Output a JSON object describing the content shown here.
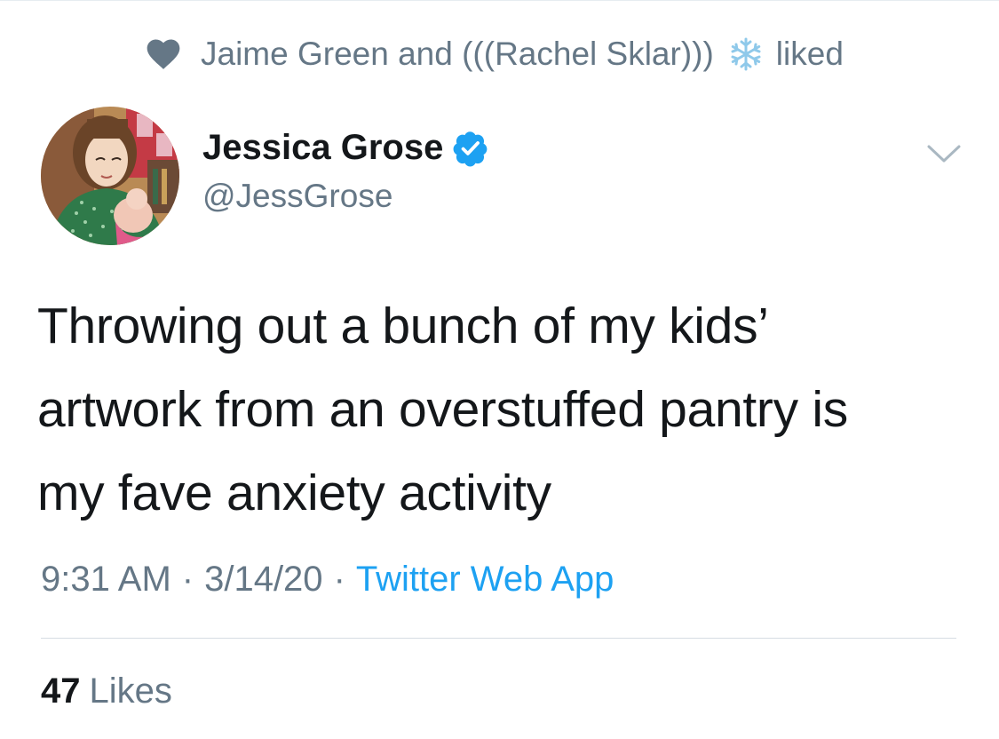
{
  "social_context": {
    "likers": "Jaime Green and (((Rachel Sklar)))",
    "action": "liked",
    "icon": "heart-icon",
    "emoji": "snowflake-icon"
  },
  "author": {
    "display_name": "Jessica Grose",
    "handle": "@JessGrose",
    "verified": true,
    "avatar": "illustrated-avatar"
  },
  "tweet": {
    "text_lines": [
      "Throwing out a bunch of my kids’",
      "artwork from an overstuffed pantry is",
      "my fave anxiety activity"
    ],
    "time": "9:31 AM",
    "date": "3/14/20",
    "separator": "·",
    "source": "Twitter Web App"
  },
  "stats": {
    "likes_count": "47",
    "likes_label": "Likes"
  },
  "colors": {
    "secondary_text": "#657786",
    "primary_text": "#14171a",
    "link": "#1da1f2",
    "verified": "#1da1f2"
  }
}
